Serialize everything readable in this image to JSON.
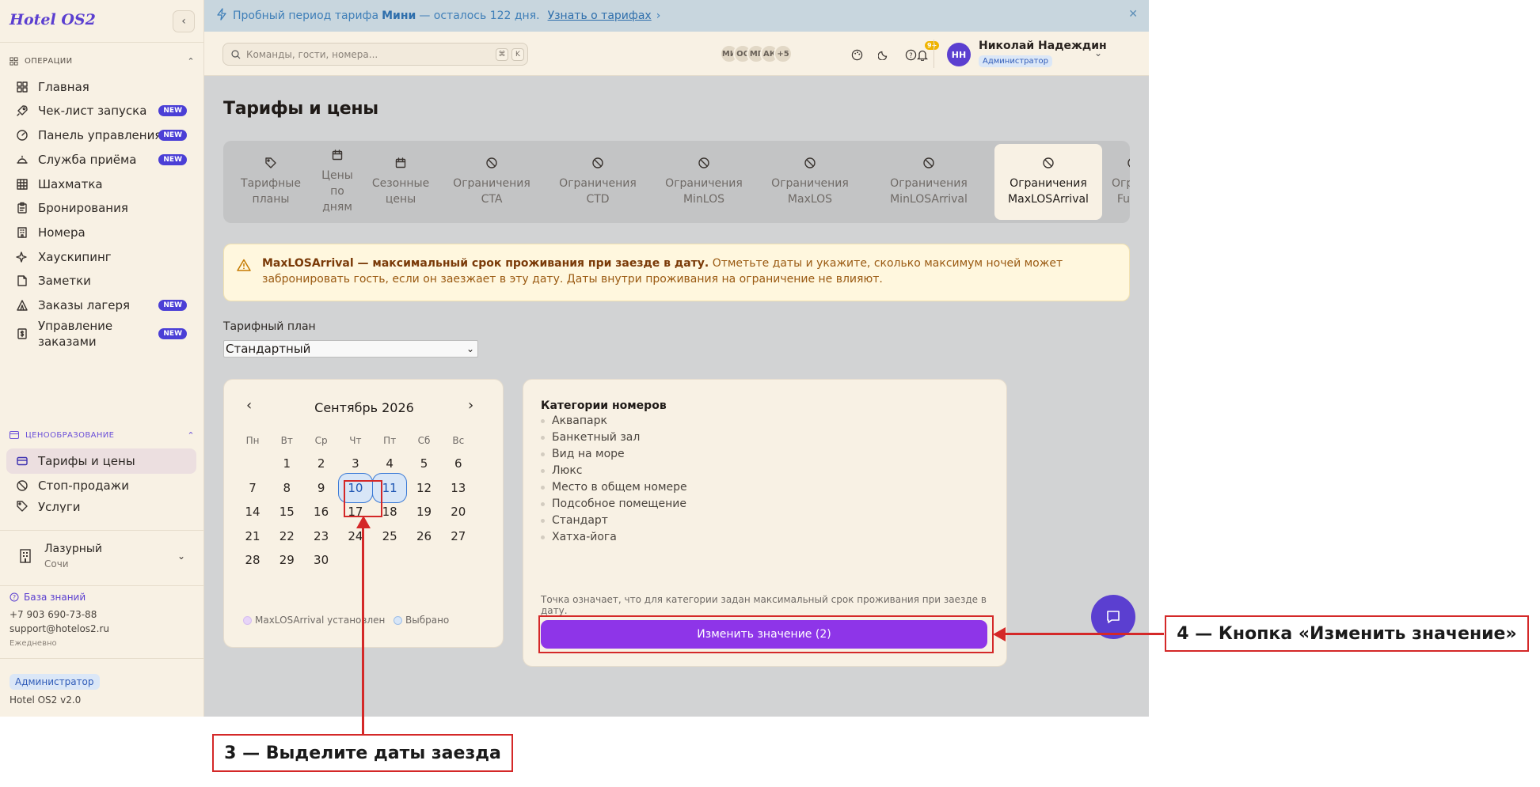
{
  "sidebar": {
    "brand": "Hotel OS2",
    "sections": {
      "operations": "ОПЕРАЦИИ",
      "pricing": "ЦЕНООБРАЗОВАНИЕ"
    },
    "new_badge": "NEW",
    "items": [
      {
        "label": "Главная",
        "icon": "grid-icon"
      },
      {
        "label": "Чек-лист запуска",
        "icon": "rocket-icon",
        "new": true
      },
      {
        "label": "Панель управления",
        "icon": "gauge-icon",
        "new": true
      },
      {
        "label": "Служба приёма",
        "icon": "bell-icon",
        "new": true
      },
      {
        "label": "Шахматка",
        "icon": "table-icon"
      },
      {
        "label": "Бронирования",
        "icon": "clipboard-icon"
      },
      {
        "label": "Номера",
        "icon": "building-icon"
      },
      {
        "label": "Хаускипинг",
        "icon": "sparkle-icon"
      },
      {
        "label": "Заметки",
        "icon": "note-icon"
      },
      {
        "label": "Заказы лагеря",
        "icon": "tent-icon",
        "new": true
      },
      {
        "label": "Управление заказами",
        "icon": "dollar-doc-icon",
        "new": true
      }
    ],
    "pricing_items": [
      {
        "label": "Тарифы и цены",
        "icon": "card-icon",
        "active": true
      },
      {
        "label": "Стоп-продажи",
        "icon": "ban-icon"
      },
      {
        "label": "Услуги",
        "icon": "tag-icon"
      }
    ],
    "hotel": {
      "name": "Лазурный",
      "city": "Сочи"
    },
    "knowledge_base": "База знаний",
    "phone": "+7 903 690-73-88",
    "email": "support@hotelos2.ru",
    "schedule": "Ежедневно",
    "role": "Администратор",
    "version": "Hotel OS2 v2.0"
  },
  "trial": {
    "prefix": "Пробный период тарифа",
    "plan": "Мини",
    "suffix": "— осталось 122 дня.",
    "link": "Узнать о тарифах"
  },
  "topbar": {
    "search_placeholder": "Команды, гости, номера...",
    "kbd1": "⌘",
    "kbd2": "K",
    "avatars": [
      "МИ",
      "ОС",
      "МГ",
      "АК",
      "+5"
    ],
    "notifications": "9+",
    "user_initials": "НН",
    "user_name": "Николай Надеждин",
    "user_role": "Администратор"
  },
  "page": {
    "title": "Тарифы и цены",
    "tabs": [
      {
        "l1": "Тарифные",
        "l2": "планы",
        "l3": "",
        "l4": "",
        "icon": "tag-icon"
      },
      {
        "l1": "Цены",
        "l2": "по",
        "l3": "дням",
        "l4": "",
        "icon": "calendar-icon"
      },
      {
        "l1": "Сезонные",
        "l2": "цены",
        "l3": "",
        "l4": "",
        "icon": "calendar-icon"
      },
      {
        "l1": "Ограничения",
        "l2": "CTA",
        "l3": "",
        "l4": "",
        "icon": "ban-icon"
      },
      {
        "l1": "Ограничения",
        "l2": "CTD",
        "l3": "",
        "l4": "",
        "icon": "ban-icon"
      },
      {
        "l1": "Ограничения",
        "l2": "MinLOS",
        "l3": "",
        "l4": "",
        "icon": "ban-icon"
      },
      {
        "l1": "Ограничения",
        "l2": "MaxLOS",
        "l3": "",
        "l4": "",
        "icon": "ban-icon"
      },
      {
        "l1": "Ограничения",
        "l2": "MinLOSArrival",
        "l3": "",
        "l4": "",
        "icon": "ban-icon"
      },
      {
        "l1": "Ограничения",
        "l2": "MaxLOSArrival",
        "l3": "",
        "l4": "",
        "icon": "ban-icon",
        "active": true
      },
      {
        "l1": "Ограни",
        "l2": "FullPa",
        "l3": "",
        "l4": "",
        "icon": "ban-icon"
      }
    ],
    "alert": {
      "bold": "MaxLOSArrival — максимальный срок проживания при заезде в дату.",
      "text": "Отметьте даты и укажите, сколько максимум ночей может забронировать гость, если он заезжает в эту дату. Даты внутри проживания на ограничение не влияют."
    },
    "plan_label": "Тарифный план",
    "plan_value": "Стандартный"
  },
  "calendar": {
    "month": "Сентябрь 2026",
    "weekdays": [
      "Пн",
      "Вт",
      "Ср",
      "Чт",
      "Пт",
      "Сб",
      "Вс"
    ],
    "first_weekday_index": 1,
    "days_in_month": 30,
    "selected": [
      10,
      11
    ],
    "legend_set": "MaxLOSArrival установлен",
    "legend_selected": "Выбрано",
    "legend_set_color": "#e7d4f7",
    "legend_selected_color": "#d8e6f7"
  },
  "categories": {
    "title": "Категории номеров",
    "items": [
      "Аквапарк",
      "Банкетный зал",
      "Вид на море",
      "Люкс",
      "Место в общем номере",
      "Подсобное помещение",
      "Стандарт",
      "Хатха-йога"
    ],
    "note": "Точка означает, что для категории задан максимальный срок проживания при заезде в дату.",
    "button": "Изменить значение (2)"
  },
  "annotations": {
    "step3": "3 — Выделите даты заезда",
    "step4": "4 — Кнопка «Изменить значение»",
    "color": "#d42828"
  }
}
